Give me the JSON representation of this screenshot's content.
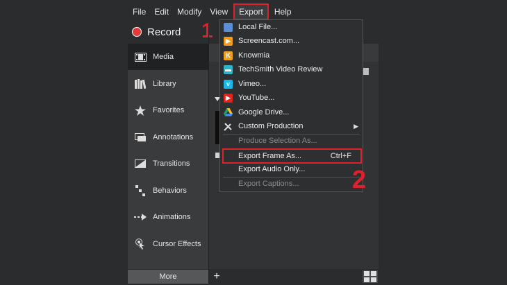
{
  "menubar": {
    "file": "File",
    "edit": "Edit",
    "modify": "Modify",
    "view": "View",
    "export": "Export",
    "help": "Help"
  },
  "record": {
    "label": "Record"
  },
  "annotations": {
    "step1": "1",
    "step2": "2"
  },
  "sidebar": {
    "items": [
      {
        "label": "Media",
        "icon": "media-icon"
      },
      {
        "label": "Library",
        "icon": "library-icon"
      },
      {
        "label": "Favorites",
        "icon": "star-icon"
      },
      {
        "label": "Annotations",
        "icon": "annotations-icon"
      },
      {
        "label": "Transitions",
        "icon": "transitions-icon"
      },
      {
        "label": "Behaviors",
        "icon": "behaviors-icon"
      },
      {
        "label": "Animations",
        "icon": "animations-icon"
      },
      {
        "label": "Cursor Effects",
        "icon": "cursor-effects-icon"
      }
    ],
    "more": "More"
  },
  "export_menu": {
    "items": [
      {
        "label": "Local File...",
        "icon": "local-file-icon"
      },
      {
        "label": "Screencast.com...",
        "icon": "screencast-icon"
      },
      {
        "label": "Knowmia",
        "icon": "knowmia-icon"
      },
      {
        "label": "TechSmith Video Review",
        "icon": "video-review-icon"
      },
      {
        "label": "Vimeo...",
        "icon": "vimeo-icon"
      },
      {
        "label": "YouTube...",
        "icon": "youtube-icon"
      },
      {
        "label": "Google Drive...",
        "icon": "google-drive-icon"
      },
      {
        "label": "Custom Production",
        "icon": "custom-production-icon"
      },
      {
        "label": "Produce Selection As..."
      },
      {
        "label": "Export Frame As...",
        "shortcut": "Ctrl+F"
      },
      {
        "label": "Export Audio Only..."
      },
      {
        "label": "Export Captions..."
      }
    ]
  },
  "colors": {
    "highlight": "#e0202a",
    "record": "#e33b3b"
  }
}
